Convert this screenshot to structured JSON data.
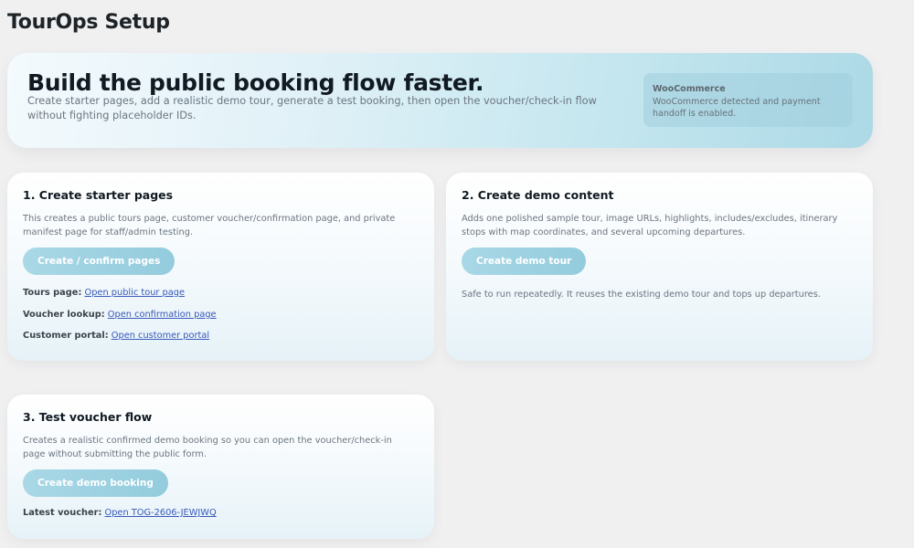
{
  "page": {
    "title": "TourOps Setup"
  },
  "hero": {
    "heading": "Build the public booking flow faster.",
    "description": "Create starter pages, add a realistic demo tour, generate a test booking, then open the voucher/check-in flow without fighting placeholder IDs.",
    "badge": {
      "title": "WooCommerce",
      "text": "WooCommerce detected and payment handoff is enabled."
    }
  },
  "cards": {
    "pages": {
      "title": "1. Create starter pages",
      "description": "This creates a public tours page, customer voucher/confirmation page, and private manifest page for staff/admin testing.",
      "button_label": "Create / confirm pages",
      "links": [
        {
          "label": "Tours page:",
          "link_text": "Open public tour page"
        },
        {
          "label": "Voucher lookup:",
          "link_text": "Open confirmation page"
        },
        {
          "label": "Customer portal:",
          "link_text": "Open customer portal"
        }
      ]
    },
    "demo": {
      "title": "2. Create demo content",
      "description": "Adds one polished sample tour, image URLs, highlights, includes/excludes, itinerary stops with map coordinates, and several upcoming departures.",
      "button_label": "Create demo tour",
      "note": "Safe to run repeatedly. It reuses the existing demo tour and tops up departures."
    },
    "voucher": {
      "title": "3. Test voucher flow",
      "description": "Creates a realistic confirmed demo booking so you can open the voucher/check-in page without submitting the public form.",
      "button_label": "Create demo booking",
      "latest_label": "Latest voucher:",
      "latest_link": "Open TOG-2606-JEWJWQ"
    }
  },
  "colors": {
    "accent_button": "#a9d8e6",
    "link": "#3858b8",
    "background": "#f0f0f1"
  }
}
